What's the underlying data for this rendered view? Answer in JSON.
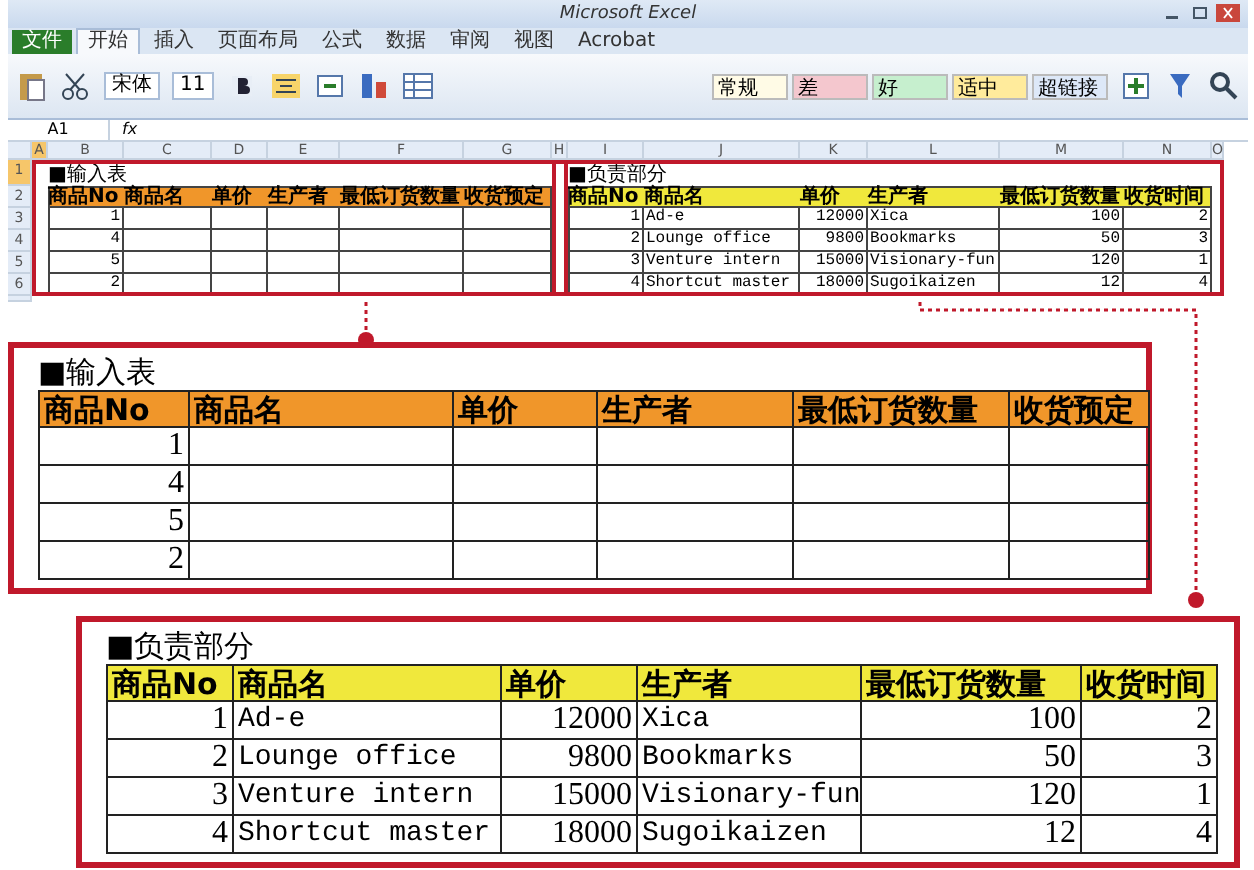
{
  "window": {
    "title": "Microsoft Excel"
  },
  "ribbon": {
    "tabs": [
      {
        "label": "文件",
        "selected": false
      },
      {
        "label": "开始",
        "selected": true
      },
      {
        "label": "插入",
        "selected": false
      },
      {
        "label": "页面布局",
        "selected": false
      },
      {
        "label": "公式",
        "selected": false
      },
      {
        "label": "数据",
        "selected": false
      },
      {
        "label": "审阅",
        "selected": false
      },
      {
        "label": "视图",
        "selected": false
      },
      {
        "label": "Acrobat",
        "selected": false
      }
    ],
    "font": "宋体",
    "font_size": "11",
    "styles": [
      {
        "label": "常规",
        "color": "#fffbe6"
      },
      {
        "label": "差",
        "color": "#f4c7ce"
      },
      {
        "label": "好",
        "color": "#c6efce"
      },
      {
        "label": "适中",
        "color": "#ffeb9c"
      },
      {
        "label": "超链接",
        "color": "#dde8f8"
      }
    ]
  },
  "formula_bar": {
    "name_box": "A1",
    "fx": "fx"
  },
  "sheet": {
    "columns": [
      "A",
      "B",
      "C",
      "D",
      "E",
      "F",
      "G",
      "H",
      "I",
      "J",
      "K",
      "L",
      "M",
      "N",
      "O"
    ],
    "rows": [
      "1",
      "2",
      "3",
      "4",
      "5",
      "6"
    ],
    "tables": [
      {
        "title": "■输入表",
        "color": "#f0962a",
        "columns": [
          "商品No",
          "商品名",
          "单价",
          "生产者",
          "最低订货数量",
          "收货预定"
        ],
        "rows": [
          [
            "1"
          ],
          [
            "4"
          ],
          [
            "5"
          ],
          [
            "2"
          ]
        ]
      },
      {
        "title": "■负责部分",
        "color": "#f0e83c",
        "columns": [
          "商品No",
          "商品名",
          "单价",
          "生产者",
          "最低订货数量",
          "收货时间"
        ],
        "rows": [
          [
            "1",
            "Ad-e",
            "12000",
            "Xica",
            "100",
            "2"
          ],
          [
            "2",
            "Lounge office",
            "9800",
            "Bookmarks",
            "50",
            "3"
          ],
          [
            "3",
            "Venture intern",
            "15000",
            "Visionary-fun",
            "120",
            "1"
          ],
          [
            "4",
            "Shortcut master",
            "18000",
            "Sugoikaizen",
            "12",
            "4"
          ]
        ]
      }
    ]
  },
  "callouts": [
    {
      "title": "■输入表",
      "color": "#f0962a",
      "columns": [
        "商品No",
        "商品名",
        "单价",
        "生产者",
        "最低订货数量",
        "收货预定"
      ],
      "rows": [
        [
          "1"
        ],
        [
          "4"
        ],
        [
          "5"
        ],
        [
          "2"
        ]
      ]
    },
    {
      "title": "■负责部分",
      "color": "#f0e83c",
      "columns": [
        "商品No",
        "商品名",
        "单价",
        "生产者",
        "最低订货数量",
        "收货时间"
      ],
      "rows": [
        [
          "1",
          "Ad-e",
          "12000",
          "Xica",
          "100",
          "2"
        ],
        [
          "2",
          "Lounge office",
          "9800",
          "Bookmarks",
          "50",
          "3"
        ],
        [
          "3",
          "Venture intern",
          "15000",
          "Visionary-fun",
          "120",
          "1"
        ],
        [
          "4",
          "Shortcut master",
          "18000",
          "Sugoikaizen",
          "12",
          "4"
        ]
      ]
    }
  ]
}
